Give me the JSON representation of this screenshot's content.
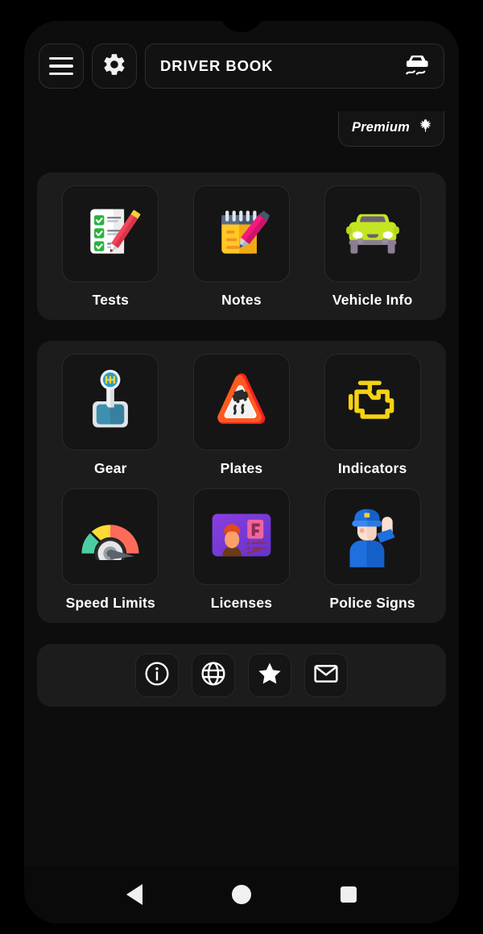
{
  "app": {
    "title": "DRIVER BOOK",
    "brand_icon": "skidding-car-icon",
    "premium_label": "Premium",
    "premium_icon": "leaf-icon"
  },
  "header": {
    "menu_icon": "hamburger-menu-icon",
    "settings_icon": "gear-icon"
  },
  "colors": {
    "screen_bg": "#0d0d0d",
    "card_bg": "#1c1c1c",
    "tile_bg": "#151515",
    "tile_border": "#2a2a2a",
    "text": "#ffffff",
    "check_green": "#27B23E",
    "pencil_red": "#F2455A",
    "note_yellow": "#FFC822",
    "pen_pink": "#F4197E",
    "car_lime": "#C3E620",
    "windshield_purple": "#6F5F75",
    "gear_blue": "#3E8FB0",
    "knob_yellow": "#F5D13A",
    "warning_orange": "#FF5A1F",
    "warning_red": "#F42020",
    "engine_yellow": "#F5D211",
    "gauge_green": "#4ECDA4",
    "gauge_yellow": "#FFDA33",
    "gauge_red": "#FF6B5B",
    "license_purple": "#7A3FD4",
    "license_pink": "#F0669B",
    "skin": "#FBE0D0",
    "police_blue": "#1E6FE0"
  },
  "sections": [
    {
      "name": "primary-card",
      "rows": [
        [
          {
            "id": "tests",
            "label": "Tests",
            "icon": "checklist-clipboard-icon"
          },
          {
            "id": "notes",
            "label": "Notes",
            "icon": "notepad-pen-icon"
          },
          {
            "id": "vehicle-info",
            "label": "Vehicle Info",
            "icon": "car-front-icon"
          }
        ]
      ]
    },
    {
      "name": "secondary-card",
      "rows": [
        [
          {
            "id": "gear",
            "label": "Gear",
            "icon": "gear-shifter-icon"
          },
          {
            "id": "plates",
            "label": "Plates",
            "icon": "slippery-road-warning-icon"
          },
          {
            "id": "indicators",
            "label": "Indicators",
            "icon": "check-engine-icon"
          }
        ],
        [
          {
            "id": "speed-limits",
            "label": "Speed Limits",
            "icon": "speedometer-gauge-icon"
          },
          {
            "id": "licenses",
            "label": "Licenses",
            "icon": "id-card-icon"
          },
          {
            "id": "police-signs",
            "label": "Police Signs",
            "icon": "police-officer-icon"
          }
        ]
      ]
    }
  ],
  "bottom_bar": [
    {
      "id": "info",
      "icon": "info-circle-icon"
    },
    {
      "id": "website",
      "icon": "globe-icon"
    },
    {
      "id": "rate",
      "icon": "star-icon"
    },
    {
      "id": "contact",
      "icon": "mail-envelope-icon"
    }
  ],
  "android_nav": [
    {
      "id": "back",
      "icon": "back-triangle-icon"
    },
    {
      "id": "home",
      "icon": "home-circle-icon"
    },
    {
      "id": "recent",
      "icon": "recents-square-icon"
    }
  ]
}
